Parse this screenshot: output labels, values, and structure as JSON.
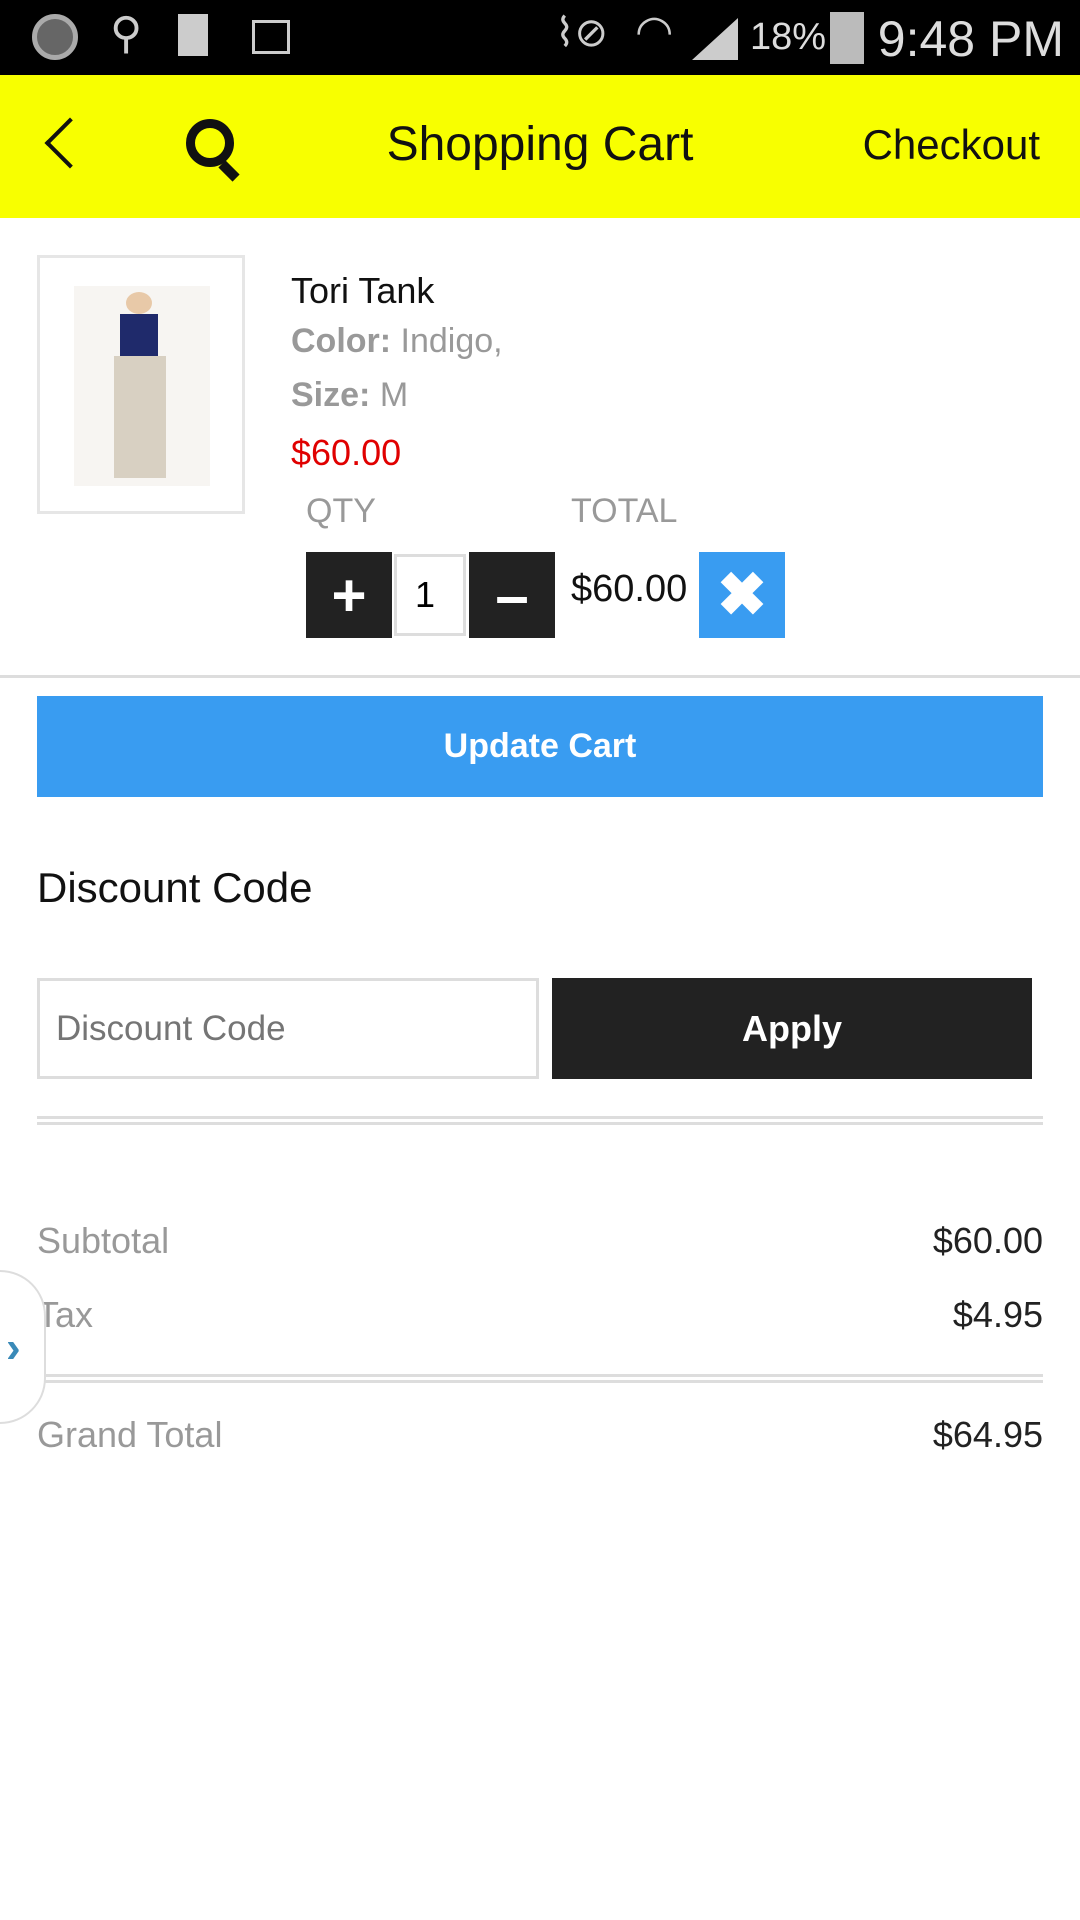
{
  "status_bar": {
    "battery": "18%",
    "time": "9:48 PM"
  },
  "header": {
    "title": "Shopping Cart",
    "checkout": "Checkout"
  },
  "cart_item": {
    "name": "Tori Tank",
    "color_label": "Color:",
    "color_value": "Indigo,",
    "size_label": "Size:",
    "size_value": "M",
    "price": "$60.00",
    "qty_label": "QTY",
    "total_label": "TOTAL",
    "qty": "1",
    "total": "$60.00"
  },
  "update_cart": "Update Cart",
  "discount": {
    "heading": "Discount Code",
    "placeholder": "Discount Code",
    "apply": "Apply"
  },
  "summary": {
    "subtotal_label": "Subtotal",
    "subtotal": "$60.00",
    "tax_label": "Tax",
    "tax": "$4.95",
    "grand_total_label": "Grand Total",
    "grand_total": "$64.95"
  },
  "colors": {
    "header": "#f8ff00",
    "accent": "#399cf1",
    "price": "#e00000"
  }
}
